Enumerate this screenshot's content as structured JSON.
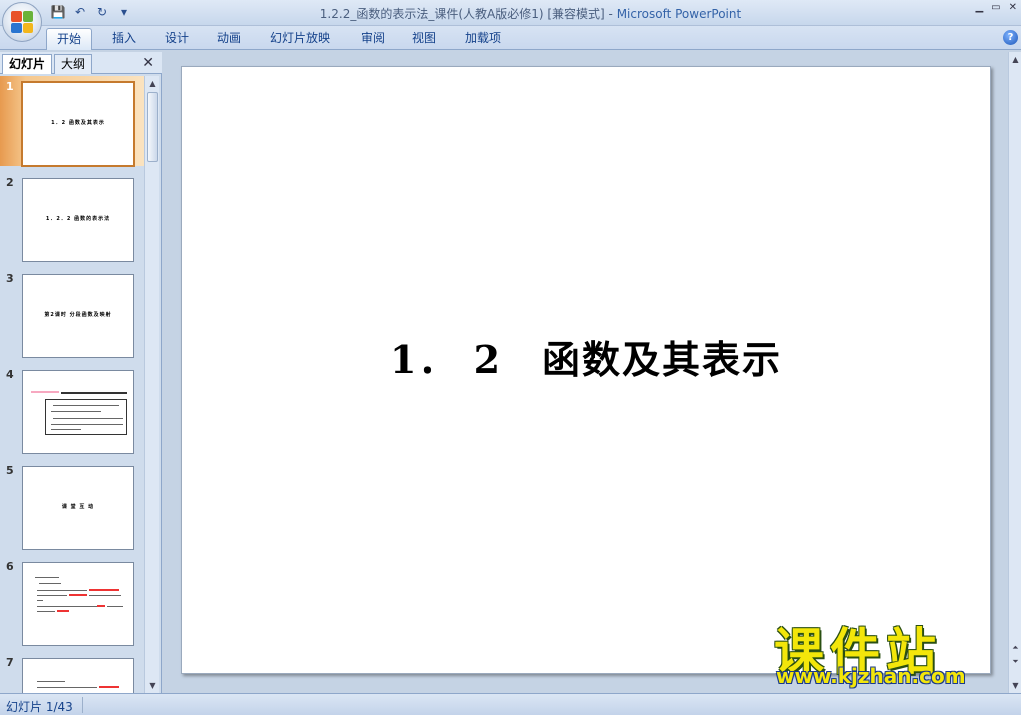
{
  "window": {
    "title": "1.2.2_函数的表示法_课件(人教A版必修1) [兼容模式]",
    "title_sep": " - ",
    "app_name": "Microsoft PowerPoint",
    "min": "▁",
    "max": "▭",
    "close": "✕"
  },
  "ribbon": {
    "tabs": [
      {
        "label": "开始"
      },
      {
        "label": "插入"
      },
      {
        "label": "设计"
      },
      {
        "label": "动画"
      },
      {
        "label": "幻灯片放映"
      },
      {
        "label": "审阅"
      },
      {
        "label": "视图"
      },
      {
        "label": "加载项"
      }
    ],
    "help": "?"
  },
  "panel": {
    "tabs": [
      {
        "label": "幻灯片"
      },
      {
        "label": "大纲"
      }
    ],
    "close": "✕"
  },
  "thumbnails": [
    {
      "num": "1",
      "title": "1．2  函数及其表示"
    },
    {
      "num": "2",
      "title": "1．2．2  函数的表示法"
    },
    {
      "num": "3",
      "title": "第2课时  分段函数及映射"
    },
    {
      "num": "4",
      "title": ""
    },
    {
      "num": "5",
      "title": "课 堂 互 动"
    },
    {
      "num": "6",
      "title": ""
    },
    {
      "num": "7",
      "title": ""
    }
  ],
  "slide": {
    "title": "1． 2　函数及其表示"
  },
  "watermark": {
    "text": "课件站",
    "url": "www.kjzhan.com"
  },
  "status": {
    "slide_info": "幻灯片 1/43"
  },
  "colors": {
    "accent": "#15428b",
    "selection": "#e79a4f",
    "watermark": "#f3e60a"
  }
}
